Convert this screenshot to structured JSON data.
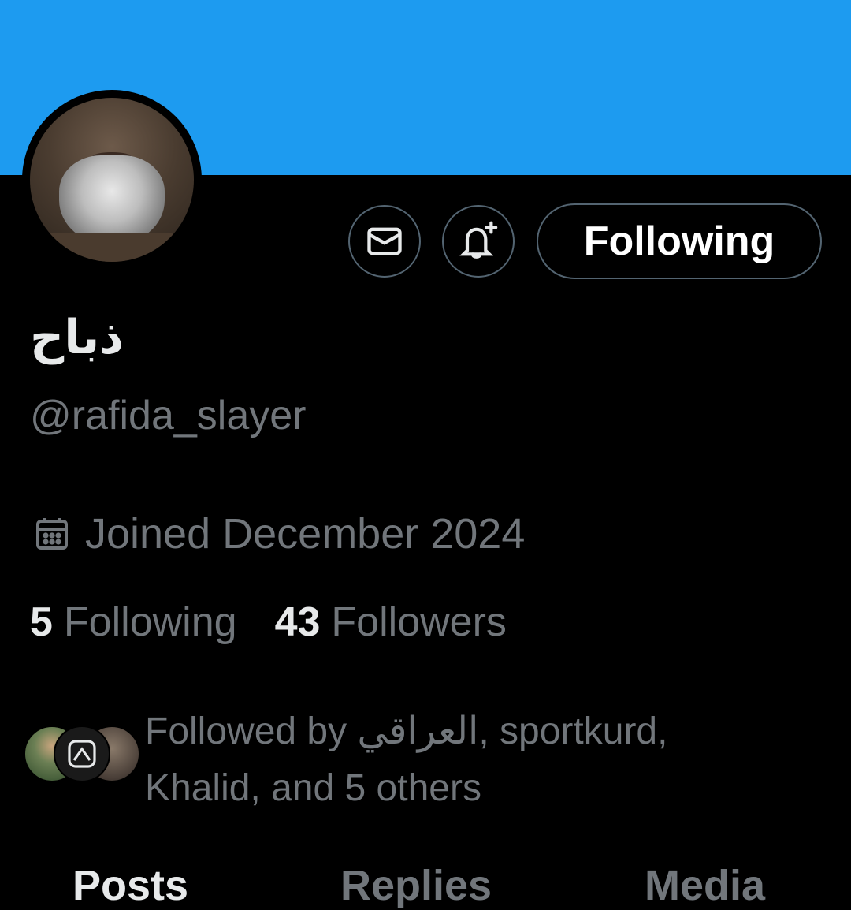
{
  "colors": {
    "banner": "#1d9bf0",
    "background": "#000000",
    "primary_text": "#e7e9ea",
    "secondary_text": "#71767b",
    "button_border": "#536471"
  },
  "actions": {
    "message_icon": "envelope-icon",
    "notify_icon": "bell-plus-icon",
    "following_label": "Following"
  },
  "profile": {
    "display_name": "ذباح",
    "handle": "@rafida_slayer",
    "joined_icon": "calendar-icon",
    "joined": "Joined December 2024"
  },
  "stats": {
    "following_count": "5",
    "following_label": "Following",
    "followers_count": "43",
    "followers_label": "Followers"
  },
  "followed_by": {
    "line1": "Followed by العراقي, sportkurd,",
    "line2": "Khalid, and 5 others"
  },
  "tabs": [
    {
      "label": "Posts",
      "active": true
    },
    {
      "label": "Replies",
      "active": false
    },
    {
      "label": "Media",
      "active": false
    }
  ]
}
